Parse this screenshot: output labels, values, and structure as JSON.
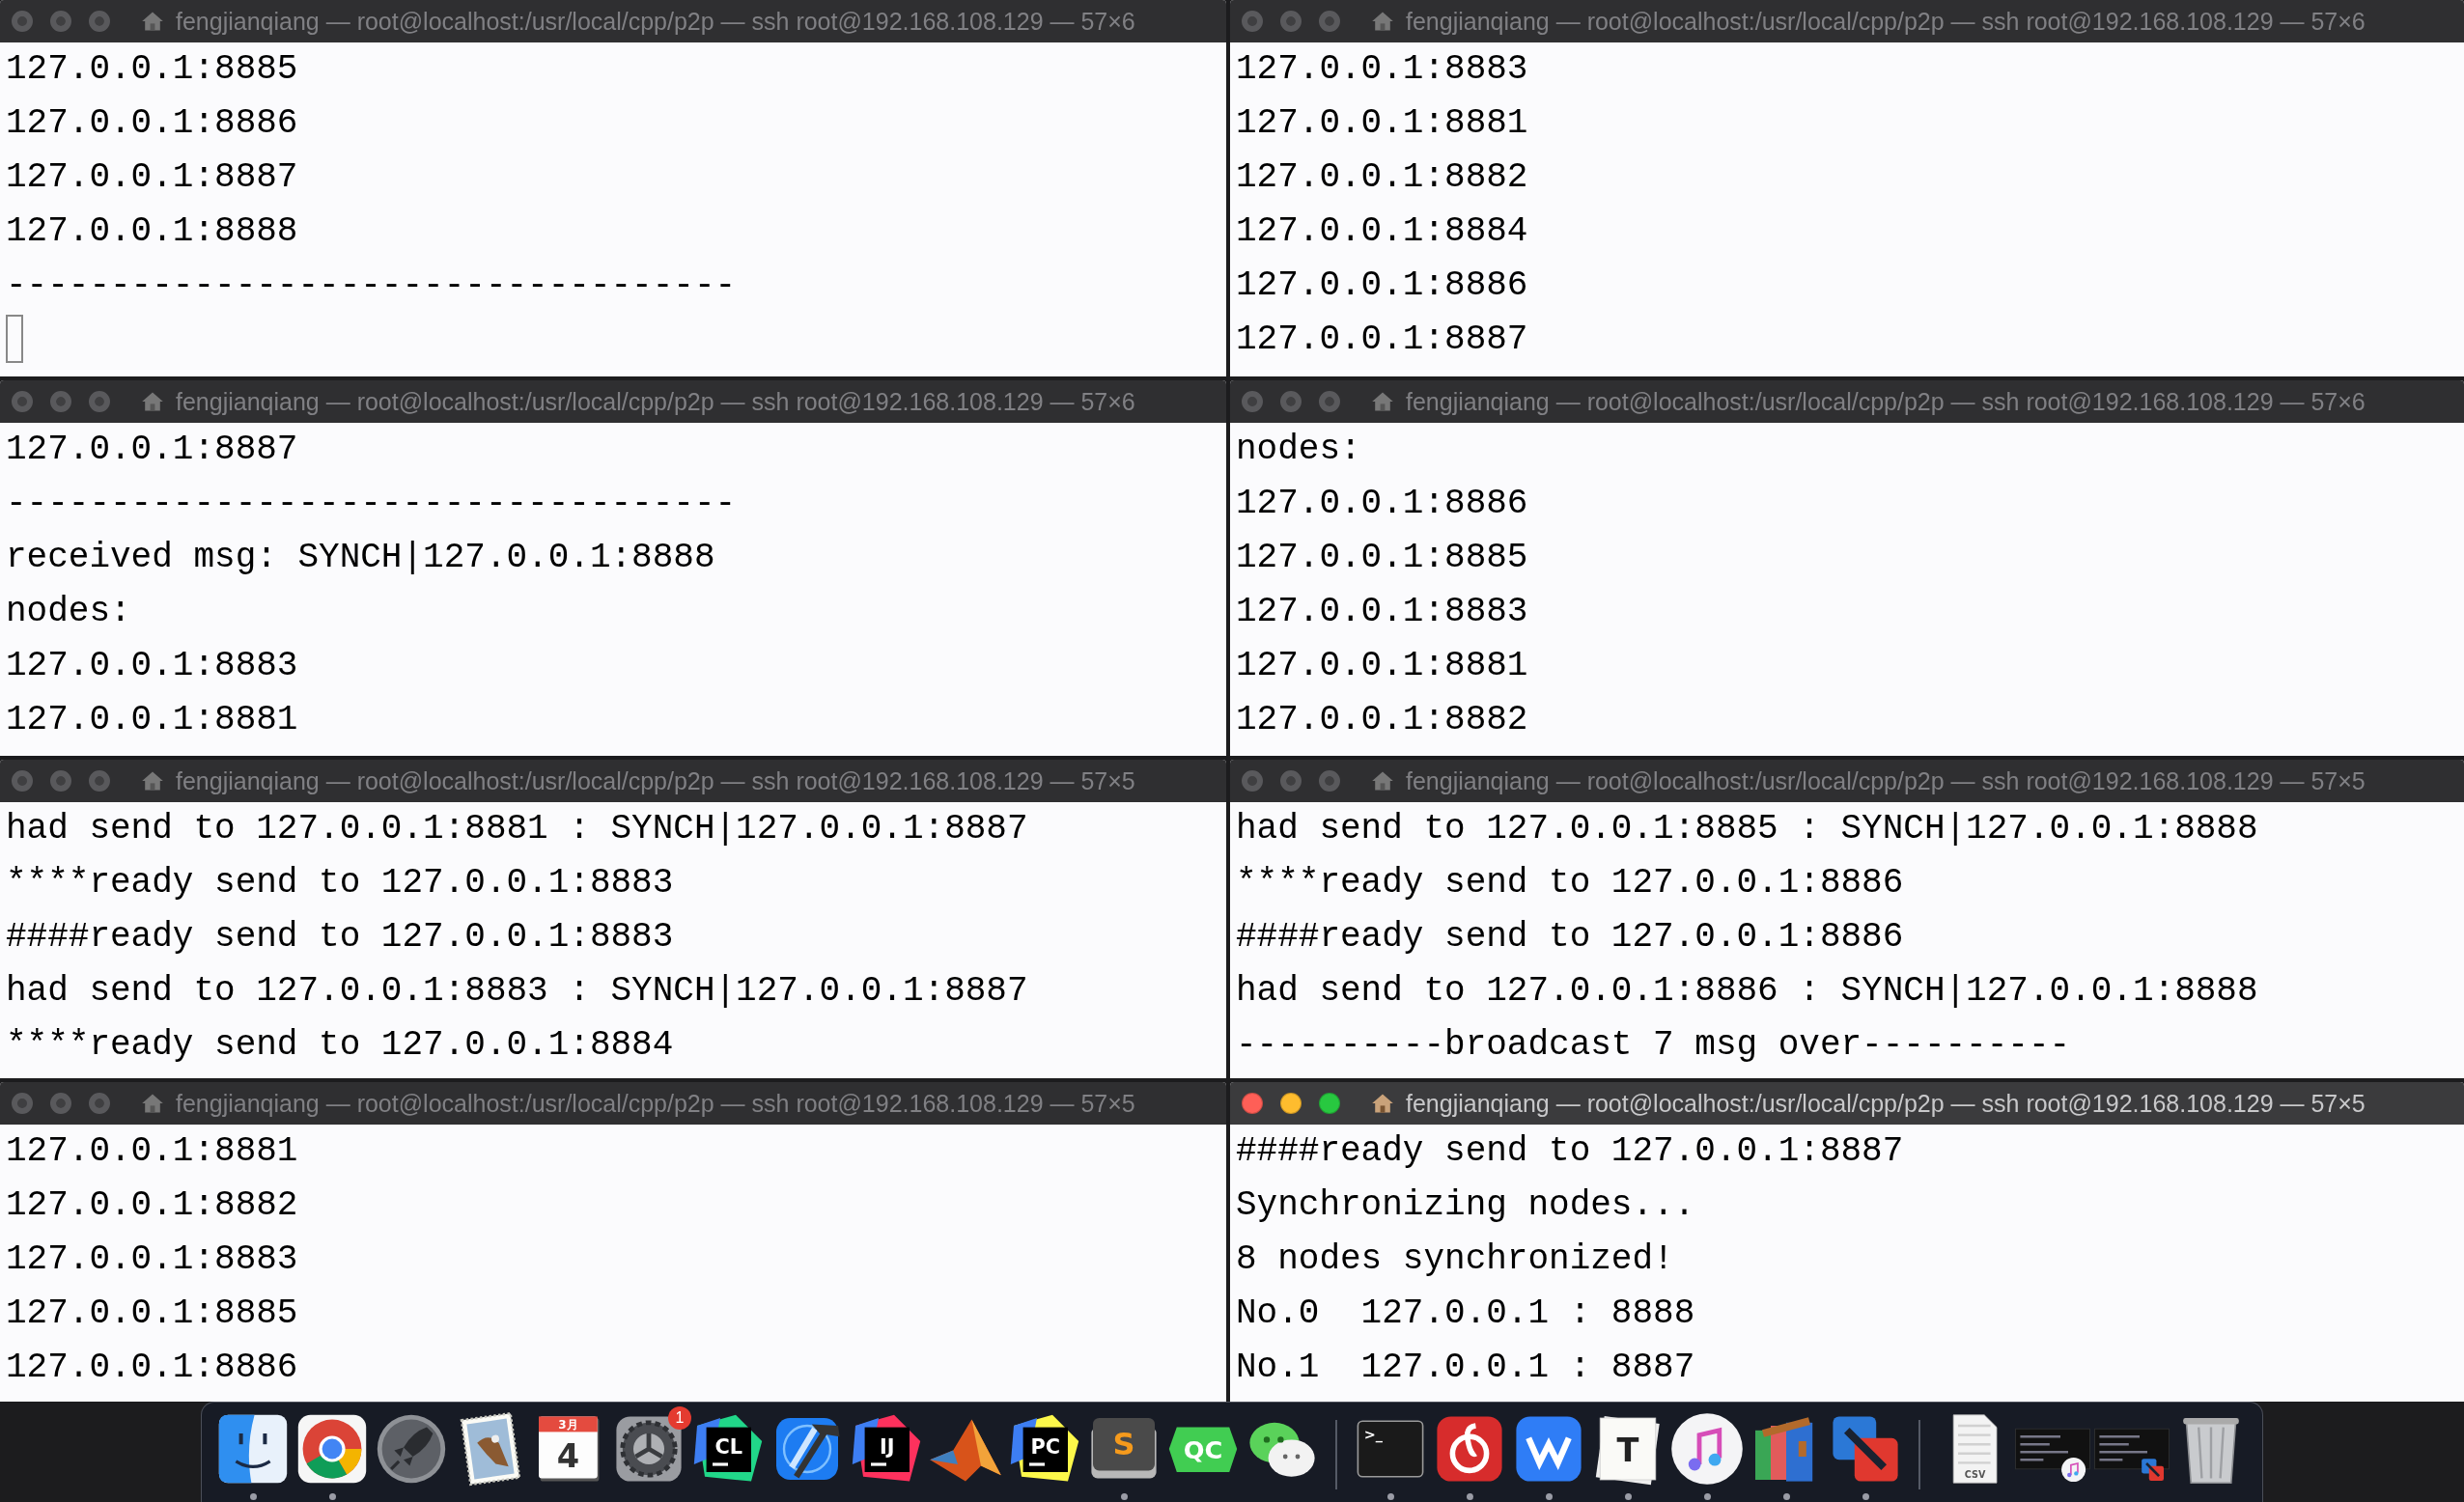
{
  "windows": [
    {
      "title": "fengjianqiang — root@localhost:/usr/local/cpp/p2p — ssh root@192.168.108.129 — 57×6",
      "active": false,
      "cursor": true,
      "lines": [
        "127.0.0.1:8885",
        "127.0.0.1:8886",
        "127.0.0.1:8887",
        "127.0.0.1:8888",
        "-----------------------------------"
      ]
    },
    {
      "title": "fengjianqiang — root@localhost:/usr/local/cpp/p2p — ssh root@192.168.108.129 — 57×6",
      "active": false,
      "cursor": false,
      "lines": [
        "127.0.0.1:8883",
        "127.0.0.1:8881",
        "127.0.0.1:8882",
        "127.0.0.1:8884",
        "127.0.0.1:8886",
        "127.0.0.1:8887"
      ]
    },
    {
      "title": "fengjianqiang — root@localhost:/usr/local/cpp/p2p — ssh root@192.168.108.129 — 57×6",
      "active": false,
      "cursor": false,
      "lines": [
        "127.0.0.1:8887",
        "-----------------------------------",
        "received msg: SYNCH|127.0.0.1:8888",
        "nodes:",
        "127.0.0.1:8883",
        "127.0.0.1:8881"
      ]
    },
    {
      "title": "fengjianqiang — root@localhost:/usr/local/cpp/p2p — ssh root@192.168.108.129 — 57×6",
      "active": false,
      "cursor": false,
      "lines": [
        "nodes:",
        "127.0.0.1:8886",
        "127.0.0.1:8885",
        "127.0.0.1:8883",
        "127.0.0.1:8881",
        "127.0.0.1:8882"
      ]
    },
    {
      "title": "fengjianqiang — root@localhost:/usr/local/cpp/p2p — ssh root@192.168.108.129 — 57×5",
      "active": false,
      "cursor": false,
      "lines": [
        "had send to 127.0.0.1:8881 : SYNCH|127.0.0.1:8887",
        "****ready send to 127.0.0.1:8883",
        "####ready send to 127.0.0.1:8883",
        "had send to 127.0.0.1:8883 : SYNCH|127.0.0.1:8887",
        "****ready send to 127.0.0.1:8884"
      ]
    },
    {
      "title": "fengjianqiang — root@localhost:/usr/local/cpp/p2p — ssh root@192.168.108.129 — 57×5",
      "active": false,
      "cursor": false,
      "lines": [
        "had send to 127.0.0.1:8885 : SYNCH|127.0.0.1:8888",
        "****ready send to 127.0.0.1:8886",
        "####ready send to 127.0.0.1:8886",
        "had send to 127.0.0.1:8886 : SYNCH|127.0.0.1:8888",
        "----------broadcast 7 msg over----------"
      ]
    },
    {
      "title": "fengjianqiang — root@localhost:/usr/local/cpp/p2p — ssh root@192.168.108.129 — 57×5",
      "active": false,
      "cursor": false,
      "lines": [
        "127.0.0.1:8881",
        "127.0.0.1:8882",
        "127.0.0.1:8883",
        "127.0.0.1:8885",
        "127.0.0.1:8886"
      ]
    },
    {
      "title": "fengjianqiang — root@localhost:/usr/local/cpp/p2p — ssh root@192.168.108.129 — 57×5",
      "active": true,
      "cursor": false,
      "lines": [
        "####ready send to 127.0.0.1:8887",
        "Synchronizing nodes...",
        "8 nodes synchronized!",
        "No.0  127.0.0.1 : 8888",
        "No.1  127.0.0.1 : 8887"
      ]
    }
  ],
  "dock": {
    "items": [
      {
        "kind": "finder",
        "running": true
      },
      {
        "kind": "browser",
        "running": true
      },
      {
        "kind": "rocket",
        "running": false
      },
      {
        "kind": "stamp",
        "running": false
      },
      {
        "kind": "calendar",
        "month": "3月",
        "day": "4",
        "running": false
      },
      {
        "kind": "gear",
        "badge": "1",
        "running": false
      },
      {
        "kind": "tile",
        "label": "CL",
        "color": "#21d789",
        "running": false
      },
      {
        "kind": "hammer",
        "running": false
      },
      {
        "kind": "tile",
        "label": "IJ",
        "color": "#fe315d",
        "running": false
      },
      {
        "kind": "peak",
        "running": false
      },
      {
        "kind": "tile",
        "label": "PC",
        "color": "#fcf84a",
        "running": false
      },
      {
        "kind": "sublime",
        "label": "S",
        "running": true
      },
      {
        "kind": "hexagon",
        "label": "QC",
        "running": false
      },
      {
        "kind": "bubbles",
        "running": false
      },
      {
        "kind": "separator"
      },
      {
        "kind": "terminal",
        "label": ">_",
        "running": true
      },
      {
        "kind": "swirl",
        "running": true
      },
      {
        "kind": "zigzag",
        "running": true
      },
      {
        "kind": "paper",
        "label": "T",
        "running": true
      },
      {
        "kind": "note",
        "running": true
      },
      {
        "kind": "books",
        "running": true
      },
      {
        "kind": "squares",
        "running": true
      },
      {
        "kind": "separator"
      },
      {
        "kind": "file",
        "label": "CSV"
      },
      {
        "kind": "thumbnote"
      },
      {
        "kind": "thumbsquares"
      },
      {
        "kind": "trash"
      }
    ]
  }
}
